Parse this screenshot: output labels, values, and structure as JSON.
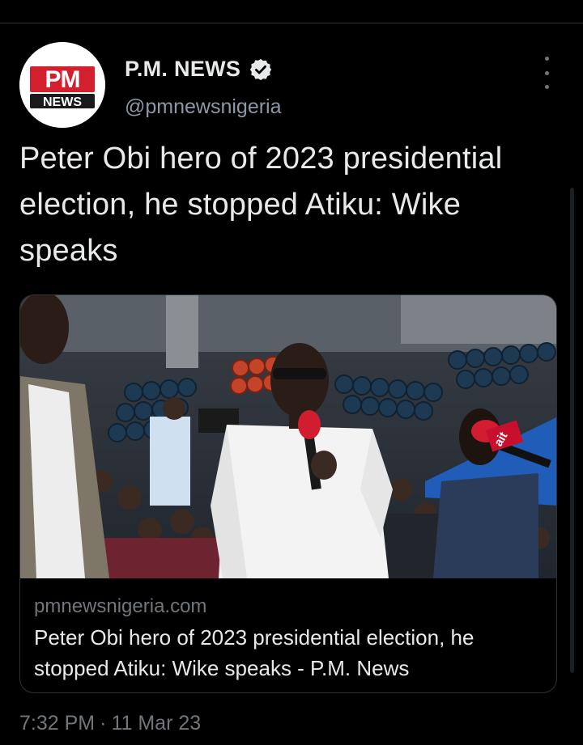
{
  "author": {
    "name": "P.M. NEWS",
    "handle": "@pmnewsnigeria",
    "verified": true,
    "avatar_logo_text": [
      "PM",
      "NEWS"
    ]
  },
  "tweet": {
    "text": "Peter Obi hero of 2023 presidential election, he stopped Atiku: Wike speaks",
    "time": "7:32 PM",
    "separator": "·",
    "date": "11 Mar 23"
  },
  "card": {
    "domain": "pmnewsnigeria.com",
    "title": "Peter Obi hero of 2023 presidential election, he stopped Atiku: Wike speaks - P.M. News",
    "microphone_logo": "ait"
  },
  "icons": {
    "verified": "verified-badge-icon",
    "more": "more-vertical-icon"
  },
  "colors": {
    "background": "#000000",
    "text_primary": "#e7e9ea",
    "text_secondary": "#71767b",
    "logo_red": "#d3202f"
  }
}
